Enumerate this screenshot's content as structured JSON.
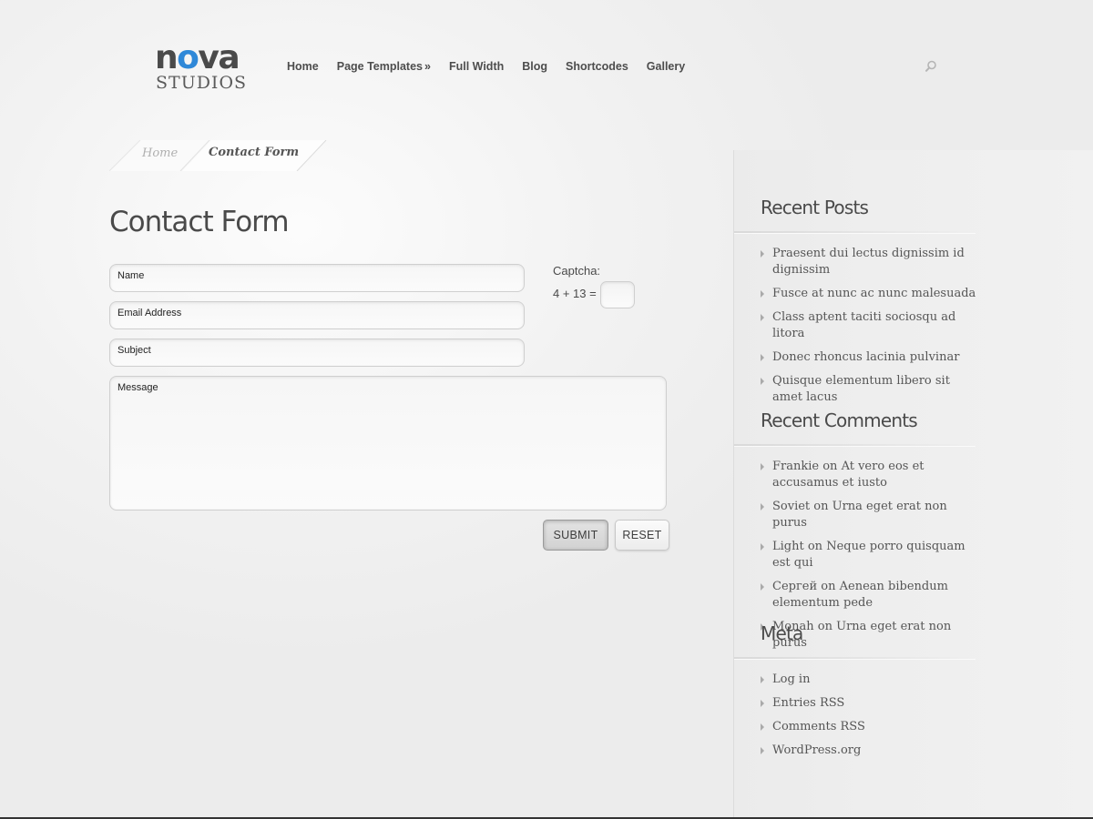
{
  "logo": {
    "word_start": "n",
    "word_accent": "o",
    "word_end": "va",
    "sub": "STUDIOS"
  },
  "nav": {
    "items": [
      {
        "label": "Home"
      },
      {
        "label": "Page Templates",
        "suffix": "»"
      },
      {
        "label": "Full Width"
      },
      {
        "label": "Blog"
      },
      {
        "label": "Shortcodes"
      },
      {
        "label": "Gallery"
      }
    ],
    "search_icon": "search-icon"
  },
  "breadcrumb": {
    "home": "Home",
    "current": "Contact Form"
  },
  "content": {
    "title": "Contact Form",
    "form": {
      "name_value": "Name",
      "email_value": "Email Address",
      "subject_value": "Subject",
      "message_value": "Message",
      "captcha_label": "Captcha:",
      "captcha_question": "4 + 13 =",
      "captcha_value": "",
      "submit_label": "SUBMIT",
      "reset_label": "RESET"
    }
  },
  "sidebar": {
    "recent_posts": {
      "title": "Recent Posts",
      "items": [
        {
          "link": "Praesent dui lectus dignissim id dignissim"
        },
        {
          "link": "Fusce at nunc ac nunc malesuada"
        },
        {
          "link": "Class aptent taciti sociosqu ad litora"
        },
        {
          "link": "Donec rhoncus lacinia pulvinar"
        },
        {
          "link": "Quisque elementum libero sit amet lacus"
        }
      ]
    },
    "recent_comments": {
      "title": "Recent Comments",
      "items": [
        {
          "author": "Frankie",
          "on": " on ",
          "link": "At vero eos et accusamus et iusto"
        },
        {
          "author": "Soviet",
          "on": " on ",
          "link": "Urna eget erat non purus"
        },
        {
          "author": "Light",
          "on": " on ",
          "link": "Neque porro quisquam est qui"
        },
        {
          "author": "Сергей",
          "on": " on ",
          "link": "Aenean bibendum elementum pede"
        },
        {
          "author": "Monah",
          "on": " on ",
          "link": "Urna eget erat non purus"
        }
      ]
    },
    "meta": {
      "title": "Meta",
      "items": [
        {
          "link": "Log in"
        },
        {
          "link": "Entries RSS"
        },
        {
          "link": "Comments RSS"
        },
        {
          "link": "WordPress.org"
        }
      ]
    }
  },
  "colors": {
    "accent": "#2f88d8",
    "text": "#4a4a4a"
  }
}
